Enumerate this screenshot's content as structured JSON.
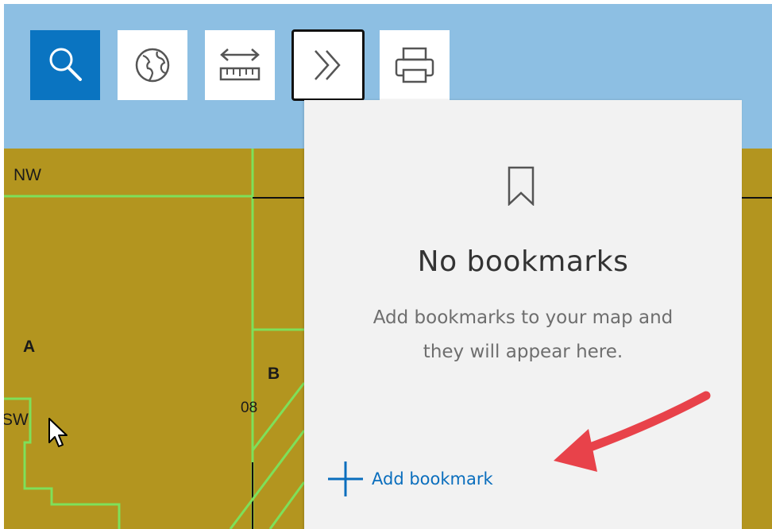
{
  "toolbar": {
    "tools": [
      {
        "name": "search",
        "icon": "search-icon"
      },
      {
        "name": "basemap",
        "icon": "globe-icon"
      },
      {
        "name": "measurement",
        "icon": "ruler-icon"
      },
      {
        "name": "bookmarks",
        "icon": "double-chevron-right-icon"
      },
      {
        "name": "print",
        "icon": "printer-icon"
      }
    ],
    "active_color": "#0a74c1"
  },
  "map": {
    "labels": {
      "nw": "NW",
      "a": "A",
      "b": "B",
      "sw": "SW",
      "num": "08"
    },
    "fill_color": "#b3951f",
    "line_color": "#7ee05a"
  },
  "bookmarks_panel": {
    "title": "No bookmarks",
    "description": "Add bookmarks to your map and they will appear here.",
    "add_label": "Add bookmark",
    "icon": "bookmark-icon"
  },
  "annotation": {
    "arrow_color": "#e8424a"
  }
}
